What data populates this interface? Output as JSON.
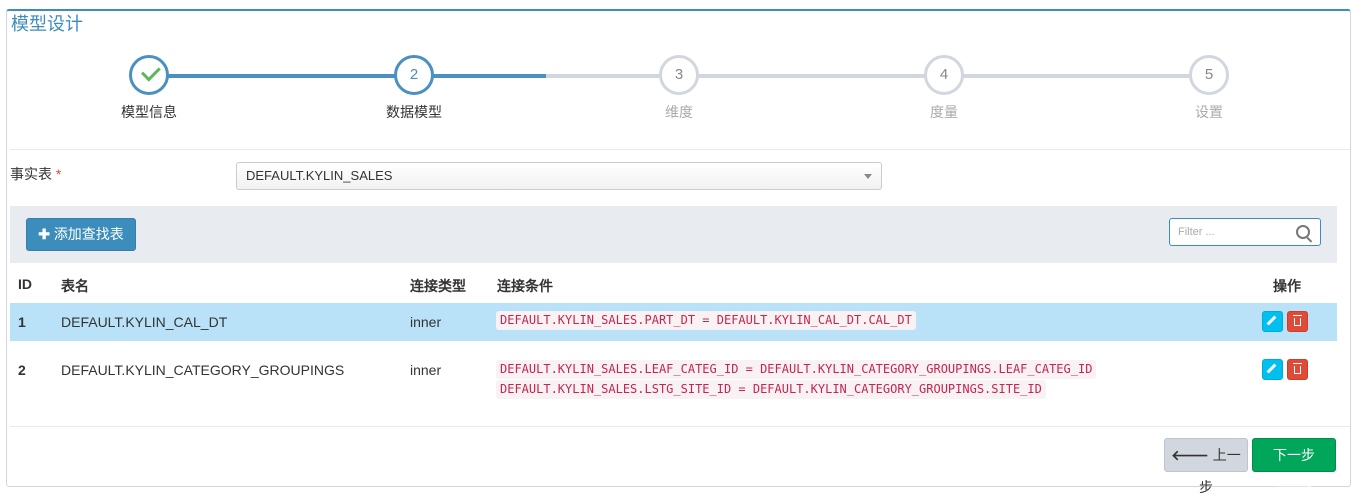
{
  "panel": {
    "title": "模型设计"
  },
  "steps": [
    {
      "number": "",
      "label": "模型信息",
      "state": "done"
    },
    {
      "number": "2",
      "label": "数据模型",
      "state": "current"
    },
    {
      "number": "3",
      "label": "维度",
      "state": "todo"
    },
    {
      "number": "4",
      "label": "度量",
      "state": "todo"
    },
    {
      "number": "5",
      "label": "设置",
      "state": "todo"
    }
  ],
  "fact_table": {
    "label": "事实表",
    "required_mark": "*",
    "selected": "DEFAULT.KYLIN_SALES"
  },
  "toolbar": {
    "add_icon": "plus-icon",
    "add_label": "添加查找表",
    "filter_placeholder": "Filter ...",
    "filter_icon": "search-icon"
  },
  "table": {
    "headers": {
      "id": "ID",
      "name": "表名",
      "join_type": "连接类型",
      "join_cond": "连接条件",
      "actions": "操作"
    },
    "rows": [
      {
        "id": "1",
        "name": "DEFAULT.KYLIN_CAL_DT",
        "join_type": "inner",
        "conditions": [
          "DEFAULT.KYLIN_SALES.PART_DT = DEFAULT.KYLIN_CAL_DT.CAL_DT"
        ]
      },
      {
        "id": "2",
        "name": "DEFAULT.KYLIN_CATEGORY_GROUPINGS",
        "join_type": "inner",
        "conditions": [
          "DEFAULT.KYLIN_SALES.LEAF_CATEG_ID = DEFAULT.KYLIN_CATEGORY_GROUPINGS.LEAF_CATEG_ID",
          "DEFAULT.KYLIN_SALES.LSTG_SITE_ID = DEFAULT.KYLIN_CATEGORY_GROUPINGS.SITE_ID"
        ]
      }
    ]
  },
  "footer": {
    "prev_label": "上一步",
    "next_label": "下一步"
  },
  "colors": {
    "primary": "#3c8dbc",
    "success": "#00a65a",
    "danger": "#dd4b39",
    "info": "#00c0ef",
    "selected_row": "#b9e2f8"
  }
}
